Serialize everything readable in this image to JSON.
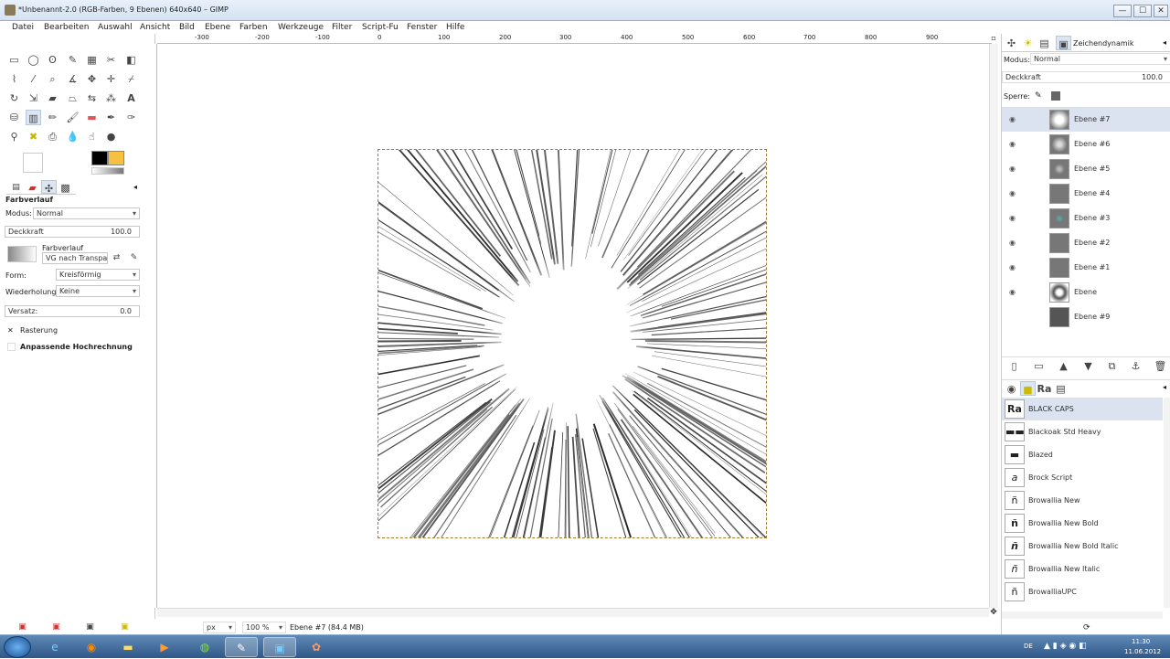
{
  "window": {
    "title": "*Unbenannt-2.0 (RGB-Farben, 9 Ebenen) 640x640 – GIMP",
    "minimize": "—",
    "maximize": "☐",
    "close": "✕"
  },
  "menu": [
    "Datei",
    "Bearbeiten",
    "Auswahl",
    "Ansicht",
    "Bild",
    "Ebene",
    "Farben",
    "Werkzeuge",
    "Filter",
    "Script-Fu",
    "Fenster",
    "Hilfe"
  ],
  "tool_options": {
    "title": "Farbverlauf",
    "modus_label": "Modus:",
    "modus_value": "Normal",
    "deckkraft_label": "Deckkraft",
    "deckkraft_value": "100.0",
    "farbverlauf_label": "Farbverlauf",
    "farbverlauf_value": "VG nach Transpar",
    "form_label": "Form:",
    "form_value": "Kreisförmig",
    "wiederholung_label": "Wiederholung:",
    "wiederholung_value": "Keine",
    "versatz_label": "Versatz:",
    "versatz_value": "0.0",
    "rasterung_label": "Rasterung",
    "hochrechnung_label": "Anpassende Hochrechnung"
  },
  "ruler": {
    "top_labels": [
      "-300",
      "-200",
      "-100",
      "0",
      "100",
      "200",
      "300",
      "400",
      "500",
      "600",
      "700",
      "800",
      "900"
    ]
  },
  "status": {
    "unit": "px",
    "zoom": "100 %",
    "info": "Ebene #7 (84.4 MB)"
  },
  "layers_panel": {
    "tab_label": "Zeichendynamik",
    "modus_label": "Modus:",
    "modus_value": "Normal",
    "deckkraft_label": "Deckkraft",
    "deckkraft_value": "100.0",
    "sperre_label": "Sperre:",
    "layers": [
      "Ebene #7",
      "Ebene #6",
      "Ebene #5",
      "Ebene #4",
      "Ebene #3",
      "Ebene #2",
      "Ebene #1",
      "Ebene",
      "Ebene #9"
    ]
  },
  "fonts_panel": {
    "fonts": [
      "BLACK CAPS",
      "Blackoak Std Heavy",
      "Blazed",
      "Brock Script",
      "Browallia New",
      "Browallia New Bold",
      "Browallia New Bold Italic",
      "Browallia New Italic",
      "BrowalliaUPC"
    ],
    "previews": [
      "Ra",
      "▬▬",
      "▬",
      "a",
      "ñ",
      "ñ",
      "ñ",
      "ñ",
      "ñ"
    ]
  },
  "taskbar": {
    "lang": "DE",
    "time": "11:30",
    "date": "11.06.2012"
  }
}
